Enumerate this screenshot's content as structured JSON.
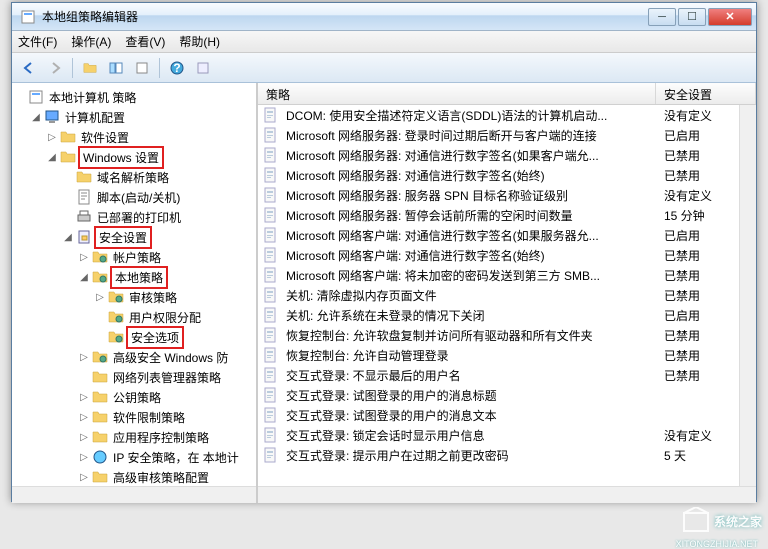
{
  "window": {
    "title": "本地组策略编辑器"
  },
  "menu": {
    "file": "文件(F)",
    "action": "操作(A)",
    "view": "查看(V)",
    "help": "帮助(H)"
  },
  "tree_root": "本地计算机 策略",
  "tree": [
    {
      "level": 1,
      "exp": "◢",
      "icon": "computer",
      "label": "计算机配置",
      "box": false
    },
    {
      "level": 2,
      "exp": "▷",
      "icon": "folder",
      "label": "软件设置",
      "box": false
    },
    {
      "level": 2,
      "exp": "◢",
      "icon": "folder",
      "label": "Windows 设置",
      "box": true
    },
    {
      "level": 3,
      "exp": "",
      "icon": "folder",
      "label": "域名解析策略",
      "box": false
    },
    {
      "level": 3,
      "exp": "",
      "icon": "script",
      "label": "脚本(启动/关机)",
      "box": false
    },
    {
      "level": 3,
      "exp": "",
      "icon": "printer",
      "label": "已部署的打印机",
      "box": false
    },
    {
      "level": 3,
      "exp": "◢",
      "icon": "security",
      "label": "安全设置",
      "box": true
    },
    {
      "level": 4,
      "exp": "▷",
      "icon": "folder-s",
      "label": "帐户策略",
      "box": false
    },
    {
      "level": 4,
      "exp": "◢",
      "icon": "folder-s",
      "label": "本地策略",
      "box": true
    },
    {
      "level": 5,
      "exp": "▷",
      "icon": "folder-s",
      "label": "审核策略",
      "box": false
    },
    {
      "level": 5,
      "exp": "",
      "icon": "folder-s",
      "label": "用户权限分配",
      "box": false
    },
    {
      "level": 5,
      "exp": "",
      "icon": "folder-s",
      "label": "安全选项",
      "box": true
    },
    {
      "level": 4,
      "exp": "▷",
      "icon": "folder-s",
      "label": "高级安全 Windows 防",
      "box": false
    },
    {
      "level": 4,
      "exp": "",
      "icon": "folder",
      "label": "网络列表管理器策略",
      "box": false
    },
    {
      "level": 4,
      "exp": "▷",
      "icon": "folder",
      "label": "公钥策略",
      "box": false
    },
    {
      "level": 4,
      "exp": "▷",
      "icon": "folder",
      "label": "软件限制策略",
      "box": false
    },
    {
      "level": 4,
      "exp": "▷",
      "icon": "folder",
      "label": "应用程序控制策略",
      "box": false
    },
    {
      "level": 4,
      "exp": "▷",
      "icon": "ip",
      "label": "IP 安全策略，在 本地计",
      "box": false
    },
    {
      "level": 4,
      "exp": "▷",
      "icon": "folder",
      "label": "高级审核策略配置",
      "box": false
    }
  ],
  "columns": {
    "policy": "策略",
    "setting": "安全设置"
  },
  "policies": [
    {
      "name": "DCOM: 使用安全描述符定义语言(SDDL)语法的计算机启动...",
      "setting": "没有定义"
    },
    {
      "name": "Microsoft 网络服务器: 登录时间过期后断开与客户端的连接",
      "setting": "已启用"
    },
    {
      "name": "Microsoft 网络服务器: 对通信进行数字签名(如果客户端允...",
      "setting": "已禁用"
    },
    {
      "name": "Microsoft 网络服务器: 对通信进行数字签名(始终)",
      "setting": "已禁用"
    },
    {
      "name": "Microsoft 网络服务器: 服务器 SPN 目标名称验证级别",
      "setting": "没有定义"
    },
    {
      "name": "Microsoft 网络服务器: 暂停会话前所需的空闲时间数量",
      "setting": "15 分钟"
    },
    {
      "name": "Microsoft 网络客户端: 对通信进行数字签名(如果服务器允...",
      "setting": "已启用"
    },
    {
      "name": "Microsoft 网络客户端: 对通信进行数字签名(始终)",
      "setting": "已禁用"
    },
    {
      "name": "Microsoft 网络客户端: 将未加密的密码发送到第三方 SMB...",
      "setting": "已禁用"
    },
    {
      "name": "关机: 清除虚拟内存页面文件",
      "setting": "已禁用"
    },
    {
      "name": "关机: 允许系统在未登录的情况下关闭",
      "setting": "已启用"
    },
    {
      "name": "恢复控制台: 允许软盘复制并访问所有驱动器和所有文件夹",
      "setting": "已禁用"
    },
    {
      "name": "恢复控制台: 允许自动管理登录",
      "setting": "已禁用"
    },
    {
      "name": "交互式登录: 不显示最后的用户名",
      "setting": "已禁用"
    },
    {
      "name": "交互式登录: 试图登录的用户的消息标题",
      "setting": ""
    },
    {
      "name": "交互式登录: 试图登录的用户的消息文本",
      "setting": ""
    },
    {
      "name": "交互式登录: 锁定会话时显示用户信息",
      "setting": "没有定义"
    },
    {
      "name": "交互式登录: 提示用户在过期之前更改密码",
      "setting": "5 天"
    }
  ],
  "watermark": {
    "main": "系统之家",
    "sub": "XITONGZHIJIA.NET"
  }
}
